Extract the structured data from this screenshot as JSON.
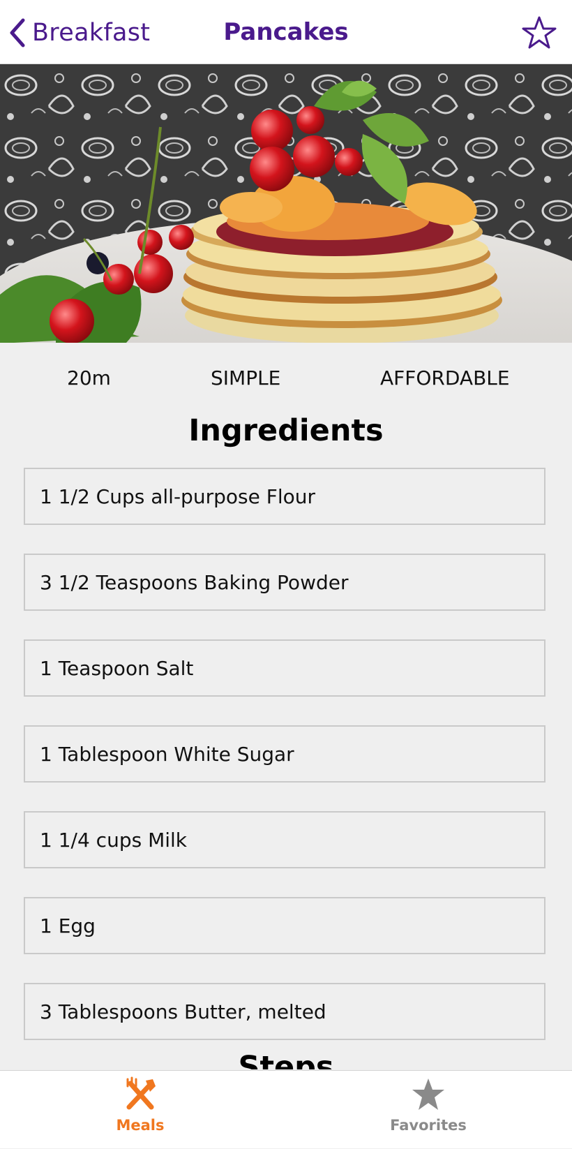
{
  "header": {
    "back_label": "Breakfast",
    "back_icon": "chevron-left-icon",
    "title": "Pancakes",
    "favorite_icon": "star-outline-icon"
  },
  "meal": {
    "duration": "20m",
    "complexity": "SIMPLE",
    "affordability": "AFFORDABLE"
  },
  "ingredients_title": "Ingredients",
  "ingredients": [
    "1 1/2 Cups all-purpose Flour",
    "3 1/2 Teaspoons Baking Powder",
    "1 Teaspoon Salt",
    "1 Tablespoon White Sugar",
    "1 1/4 cups Milk",
    "1 Egg",
    "3 Tablespoons Butter, melted"
  ],
  "steps_title": "Steps",
  "tabs": [
    {
      "label": "Meals",
      "icon": "fork-knife-icon",
      "active": true
    },
    {
      "label": "Favorites",
      "icon": "star-icon",
      "active": false
    }
  ],
  "colors": {
    "accent": "#4a1a8c",
    "tab_active": "#f0771f",
    "tab_inactive": "#8a8a8a",
    "background": "#efefef"
  }
}
